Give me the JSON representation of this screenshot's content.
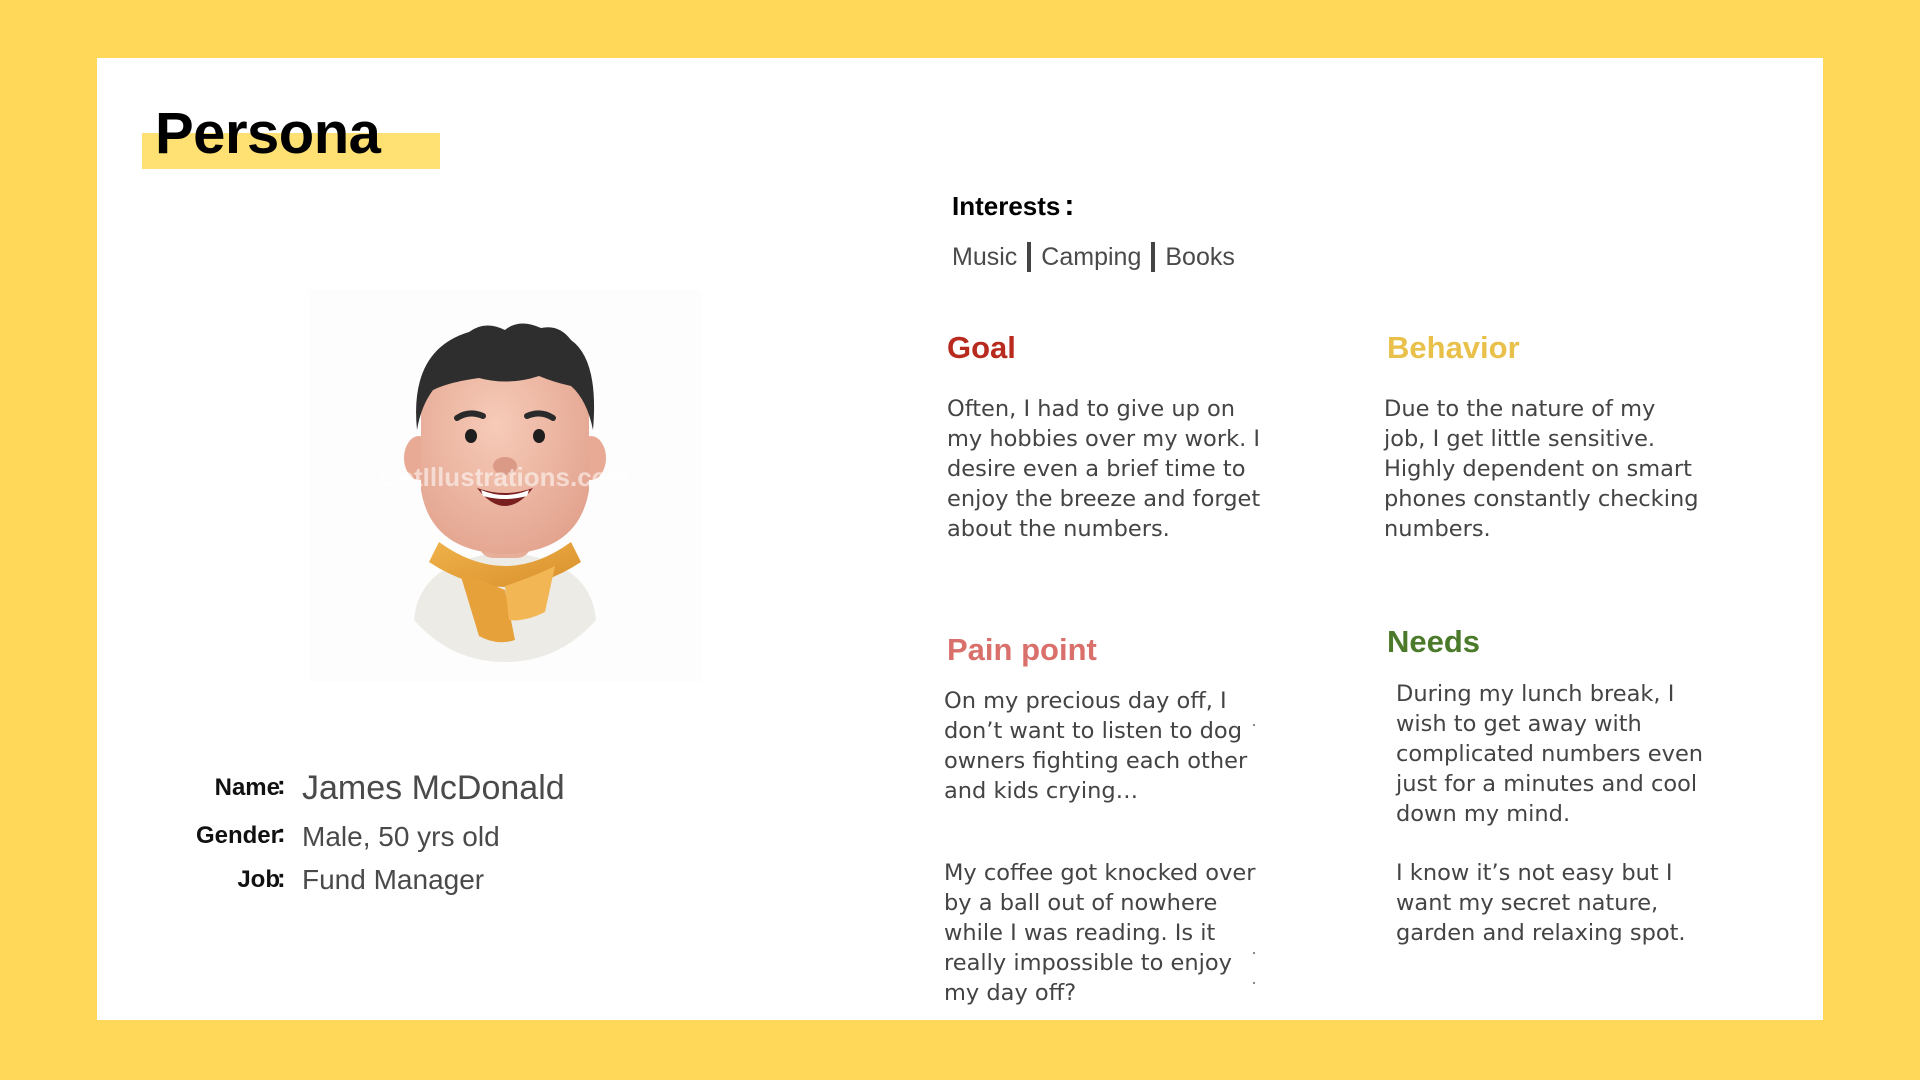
{
  "persona": {
    "title": "Persona",
    "avatar_watermark": "GetIllustrations.com",
    "name_label": "Name",
    "name_value": "James McDonald",
    "gender_label": "Gender",
    "gender_value": "Male, 50 yrs old",
    "job_label": "Job",
    "job_value": "Fund Manager",
    "colon": ":"
  },
  "interests": {
    "label": "Interests",
    "colon": ":",
    "items": [
      "Music",
      "Camping",
      "Books"
    ]
  },
  "sections": {
    "goal": {
      "title": "Goal",
      "color": "#B8291E",
      "body": "Often, I had to give up on\nmy hobbies over my work. I\ndesire even a brief time to\nenjoy the breeze and forget\nabout the numbers."
    },
    "behavior": {
      "title": "Behavior",
      "color": "#E8C04A",
      "body": "Due to the nature of my\njob, I get little sensitive.\nHighly dependent on smart\nphones constantly checking\nnumbers."
    },
    "pain_point": {
      "title": "Pain point",
      "color": "#D9706C",
      "body_1": "On my precious day off, I\ndon’t want to listen to dog\nowners fighting each other\nand kids crying…",
      "body_2": "My coffee got knocked over\nby a ball out of nowhere\nwhile I was reading. Is it\nreally impossible to enjoy\nmy day off?"
    },
    "needs": {
      "title": "Needs",
      "color": "#4A7A2A",
      "body_1": "During my lunch break, I\nwish to get away with\ncomplicated numbers even\njust for a minutes and cool\ndown my mind.",
      "body_2": "I know it’s not easy but I\nwant my secret nature,\ngarden and relaxing spot."
    }
  }
}
